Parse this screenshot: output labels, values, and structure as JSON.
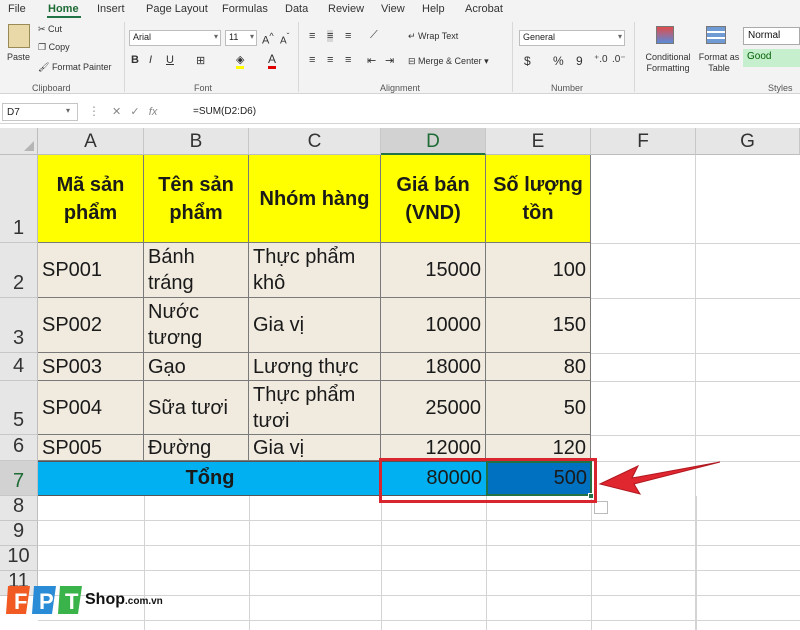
{
  "ribbon": {
    "tabs": [
      "File",
      "Home",
      "Insert",
      "Page Layout",
      "Formulas",
      "Data",
      "Review",
      "View",
      "Help",
      "Acrobat"
    ],
    "clipboard": {
      "paste": "Paste",
      "cut": "Cut",
      "copy": "Copy",
      "format_painter": "Format Painter",
      "label": "Clipboard"
    },
    "font": {
      "name": "Arial",
      "size": "11",
      "label": "Font"
    },
    "alignment": {
      "wrap_text": "Wrap Text",
      "merge_center": "Merge & Center",
      "label": "Alignment"
    },
    "number": {
      "format": "General",
      "label": "Number",
      "currency": "$",
      "percent": "%",
      "comma": "9"
    },
    "styles": {
      "conditional_formatting": "Conditional Formatting",
      "format_as_table": "Format as Table",
      "normal": "Normal",
      "good": "Good",
      "label": "Styles"
    },
    "font_buttons": [
      "B",
      "I",
      "U"
    ]
  },
  "formula_bar": {
    "name_box": "D7",
    "fx": "fx",
    "formula": "=SUM(D2:D6)"
  },
  "columns": [
    "A",
    "B",
    "C",
    "D",
    "E",
    "F",
    "G"
  ],
  "rows": [
    "1",
    "2",
    "3",
    "4",
    "5",
    "6",
    "7",
    "8",
    "9",
    "10",
    "11"
  ],
  "table": {
    "headers": [
      "Mã sản phẩm",
      "Tên sản phẩm",
      "Nhóm hàng",
      "Giá bán (VND)",
      "Số lượng tồn"
    ],
    "rows": [
      [
        "SP001",
        "Bánh tráng",
        "Thực phẩm khô",
        "15000",
        "100"
      ],
      [
        "SP002",
        "Nước tương",
        "Gia vị",
        "10000",
        "150"
      ],
      [
        "SP003",
        "Gạo",
        "Lương thực",
        "18000",
        "80"
      ],
      [
        "SP004",
        "Sữa tươi",
        "Thực phẩm tươi",
        "25000",
        "50"
      ],
      [
        "SP005",
        "Đường",
        "Gia vị",
        "12000",
        "120"
      ]
    ],
    "total_label": "Tổng",
    "total_price": "80000",
    "total_qty": "500"
  },
  "branding": {
    "name": "Shop",
    "domain": ".com.vn",
    "logo_letters": [
      "F",
      "P",
      "T"
    ]
  },
  "colors": {
    "header_fill": "#ffff00",
    "total_fill": "#00b0f0",
    "selected_fill": "#0070c0",
    "data_fill": "#f0eadf",
    "highlight": "#d9262e",
    "excel_green": "#217346"
  }
}
